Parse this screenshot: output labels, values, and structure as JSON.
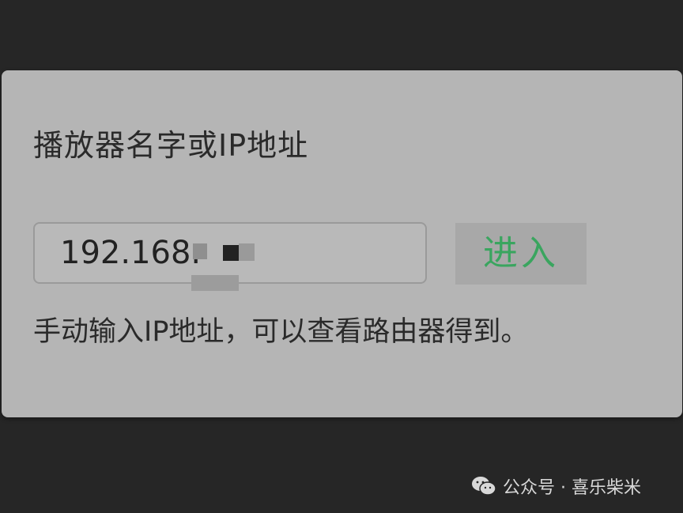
{
  "dialog": {
    "label": "播放器名字或IP地址",
    "input_value": "192.168.",
    "enter_label": "进入",
    "hint": "手动输入IP地址，可以查看路由器得到。"
  },
  "watermark": {
    "icon": "wechat-icon",
    "text": "公众号 · 喜乐柴米"
  },
  "colors": {
    "background": "#262626",
    "dialog": "#b5b5b5",
    "accent": "#3aa55f"
  }
}
